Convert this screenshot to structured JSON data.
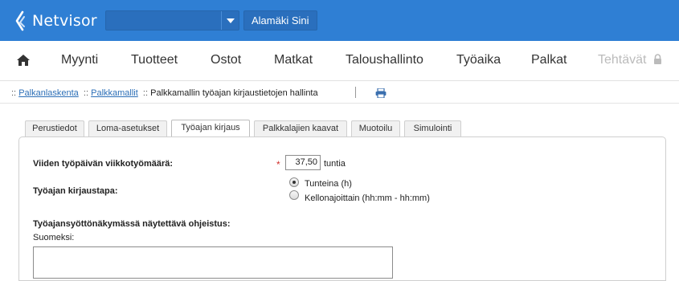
{
  "header": {
    "logo_text": "Netvisor",
    "company_select_value": "",
    "user_button": "Alamäki Sini",
    "brand_color": "#2f7fd4"
  },
  "nav": {
    "home_icon": "home-icon",
    "items": [
      {
        "label": "Myynti"
      },
      {
        "label": "Tuotteet"
      },
      {
        "label": "Ostot"
      },
      {
        "label": "Matkat"
      },
      {
        "label": "Taloushallinto"
      },
      {
        "label": "Työaika"
      },
      {
        "label": "Palkat"
      },
      {
        "label": "Tehtävät",
        "disabled": true,
        "icon": "lock-icon"
      }
    ]
  },
  "breadcrumb": {
    "sep": "::",
    "items": [
      {
        "label": "Palkanlaskenta",
        "link": true
      },
      {
        "label": "Palkkamallit",
        "link": true
      },
      {
        "label": "Palkkamallin työajan kirjaustietojen hallinta",
        "link": false
      }
    ],
    "print_icon": "print-icon"
  },
  "tabs": [
    {
      "label": "Perustiedot"
    },
    {
      "label": "Loma-asetukset"
    },
    {
      "label": "Työajan kirjaus",
      "active": true
    },
    {
      "label": "Palkkalajien kaavat"
    },
    {
      "label": "Muotoilu"
    },
    {
      "label": "Simulointi"
    }
  ],
  "form": {
    "weekly_hours_label": "Viiden työpäivän viikkotyömäärä:",
    "required_mark": "*",
    "weekly_hours_value": "37,50",
    "weekly_hours_unit": "tuntia",
    "entry_method_label": "Työajan kirjaustapa:",
    "entry_options": [
      {
        "label": "Tunteina (h)",
        "checked": true
      },
      {
        "label": "Kellonajoittain (hh:mm - hh:mm)",
        "checked": false
      }
    ],
    "instructions_label": "Työajansyöttönäkymässä näytettävä ohjeistus:",
    "finnish_label": "Suomeksi:",
    "finnish_value": ""
  }
}
